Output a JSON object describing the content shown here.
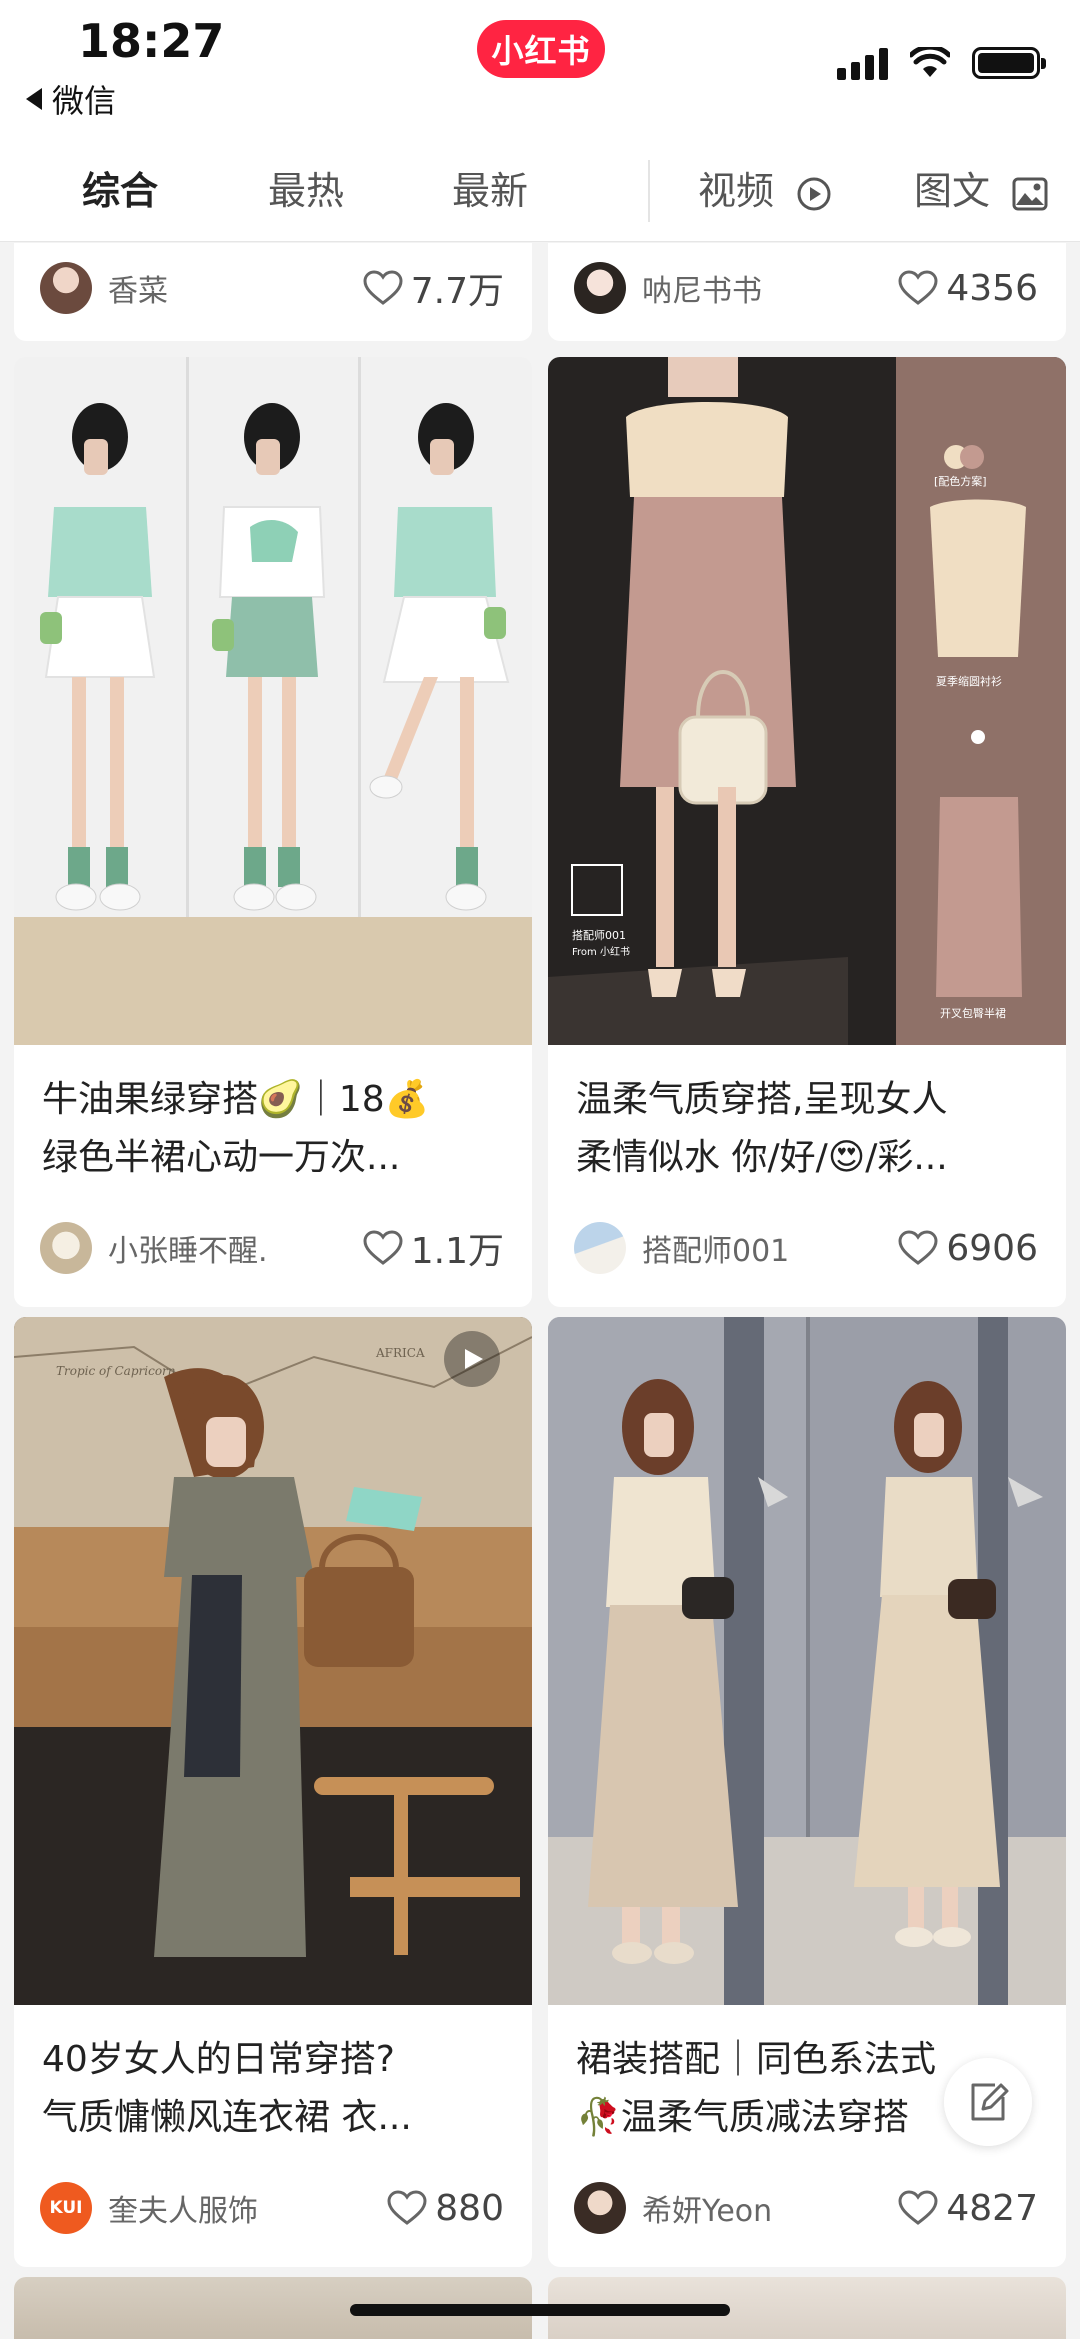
{
  "status_bar": {
    "time": "18:27",
    "back_label": "微信",
    "brand": "小红书"
  },
  "tabs": [
    {
      "label": "综合",
      "active": true
    },
    {
      "label": "最热",
      "active": false
    },
    {
      "label": "最新",
      "active": false
    },
    {
      "label": "视频",
      "icon": "play-circle-icon"
    },
    {
      "label": "图文",
      "icon": "image-icon"
    }
  ],
  "cards": [
    {
      "author": "香菜",
      "likes": "7.7万"
    },
    {
      "author": "呐尼书书",
      "likes": "4356"
    },
    {
      "title_lines": [
        "牛油果绿穿搭🥑｜18💰",
        "绿色半裙心动一万次..."
      ],
      "author": "小张睡不醒.",
      "likes": "1.1万"
    },
    {
      "title_lines": [
        "温柔气质穿搭,呈现女人",
        "柔情似水 你/好/😍/彩..."
      ],
      "author": "搭配师001",
      "likes": "6906",
      "overlay": {
        "watermark": "搭配师001",
        "watermark_sub": "From 小红书",
        "tag": "[配色方案]",
        "item1": "夏季缩圆衬衫",
        "item2": "开叉包臀半裙"
      }
    },
    {
      "title_lines": [
        "40岁女人的日常穿搭?",
        "气质慵懒风连衣裙 衣..."
      ],
      "author": "奎夫人服饰",
      "likes": "880",
      "avatar_text": "KUI",
      "has_video": true,
      "map_text": "Tropic of Capricorn",
      "map_text2": "AFRICA"
    },
    {
      "title_lines": [
        "裙装搭配｜同色系法式",
        "🥀温柔气质减法穿搭"
      ],
      "author": "希妍Yeon",
      "likes": "4827"
    }
  ],
  "colors": {
    "brand": "#ff2442",
    "page_bg": "#f3f3f3"
  }
}
